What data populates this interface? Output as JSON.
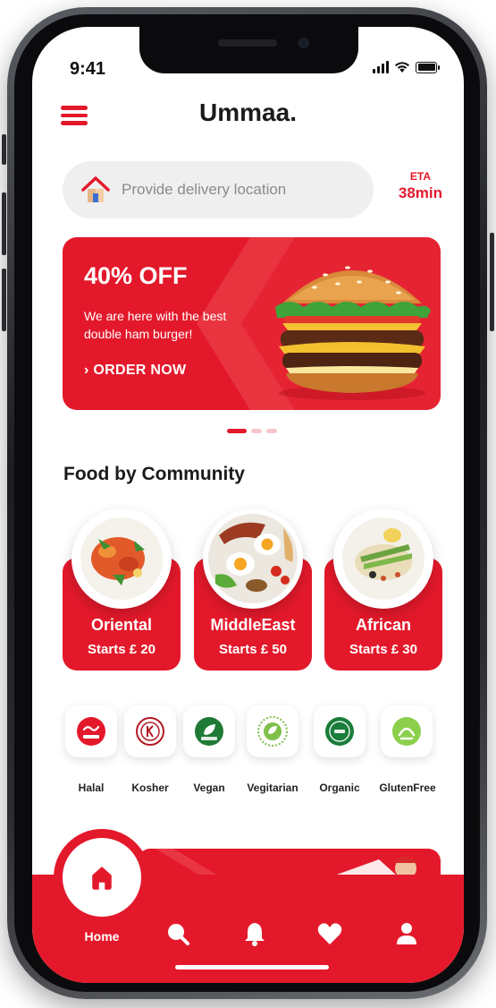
{
  "status_bar": {
    "time": "9:41"
  },
  "header": {
    "brand": "Ummaa."
  },
  "location": {
    "placeholder": "Provide delivery location"
  },
  "eta": {
    "label": "ETA",
    "value": "38min"
  },
  "promo": {
    "title": "40% OFF",
    "subtitle": "We are here with the best double ham burger!",
    "cta": "ORDER NOW",
    "active_slide": 1,
    "slide_count": 3
  },
  "community": {
    "title": "Food by Community",
    "items": [
      {
        "name": "Oriental",
        "price": "Starts £ 20"
      },
      {
        "name": "MiddleEast",
        "price": "Starts £ 50"
      },
      {
        "name": "African",
        "price": "Starts £ 30"
      }
    ]
  },
  "diets": [
    {
      "label": "Halal"
    },
    {
      "label": "Kosher"
    },
    {
      "label": "Vegan"
    },
    {
      "label": "Vegitarian"
    },
    {
      "label": "Organic"
    },
    {
      "label": "GlutenFree"
    }
  ],
  "nav": {
    "home_label": "Home",
    "items": [
      "home-icon",
      "search-icon",
      "bell-icon",
      "heart-icon",
      "profile-icon"
    ]
  },
  "colors": {
    "brand_red": "#e3192b",
    "placeholder_gray": "#8b8b8b"
  }
}
